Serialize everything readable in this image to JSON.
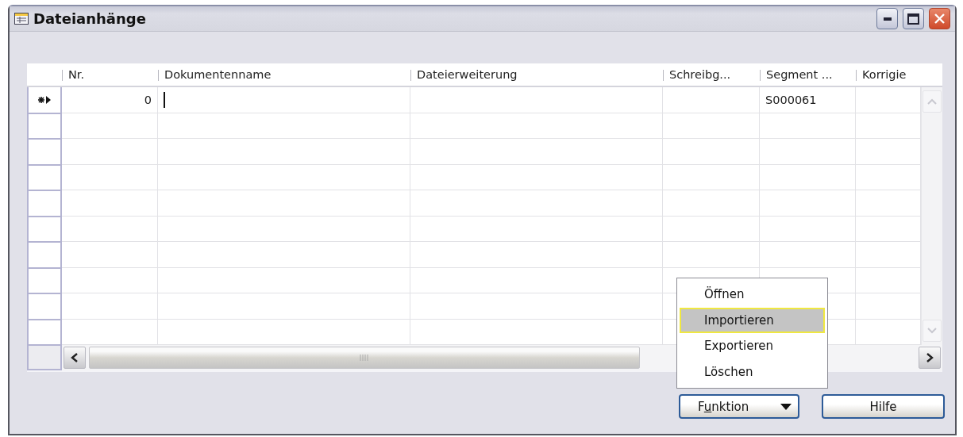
{
  "window": {
    "title": "Dateianhänge"
  },
  "table": {
    "columns": [
      "Nr.",
      "Dokumentenname",
      "Dateierweiterung",
      "Schreibg...",
      "Segment ...",
      "Korrigie"
    ],
    "rows": [
      {
        "current": true,
        "editing": true,
        "cells": [
          "0",
          null,
          null,
          null,
          "S000061",
          null
        ]
      }
    ]
  },
  "menu": {
    "items": [
      {
        "label": "Öffnen",
        "selected": false
      },
      {
        "label": "Importieren",
        "selected": true
      },
      {
        "label": "Exportieren",
        "selected": false
      },
      {
        "label": "Löschen",
        "selected": false
      }
    ]
  },
  "buttons": [
    {
      "label": "Funktion",
      "kind": "dropdown",
      "mnemonic_underlined": true
    },
    {
      "label": "Hilfe",
      "kind": "plain"
    }
  ]
}
